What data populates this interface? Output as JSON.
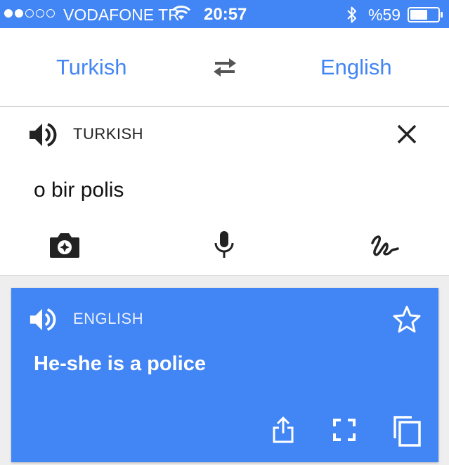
{
  "status_bar": {
    "signal_bars": 5,
    "signal_filled": 2,
    "carrier": "VODAFONE TR",
    "time": "20:57",
    "battery_percent": "%59",
    "battery_level": 0.59
  },
  "language_bar": {
    "source_language": "Turkish",
    "target_language": "English"
  },
  "input": {
    "label": "TURKISH",
    "text": "o bir polis"
  },
  "result": {
    "label": "ENGLISH",
    "text": "He-she is a police"
  },
  "colors": {
    "accent": "#4285f4",
    "text_dark": "#111111",
    "background": "#eeeeee"
  },
  "icons": {
    "status": [
      "wifi-icon",
      "bluetooth-icon",
      "battery-icon"
    ],
    "language_bar": [
      "swap-languages-icon"
    ],
    "input": [
      "speaker-icon",
      "close-icon",
      "camera-icon",
      "microphone-icon",
      "handwriting-icon"
    ],
    "result": [
      "speaker-icon",
      "star-icon",
      "share-icon",
      "fullscreen-icon",
      "copy-icon"
    ]
  }
}
